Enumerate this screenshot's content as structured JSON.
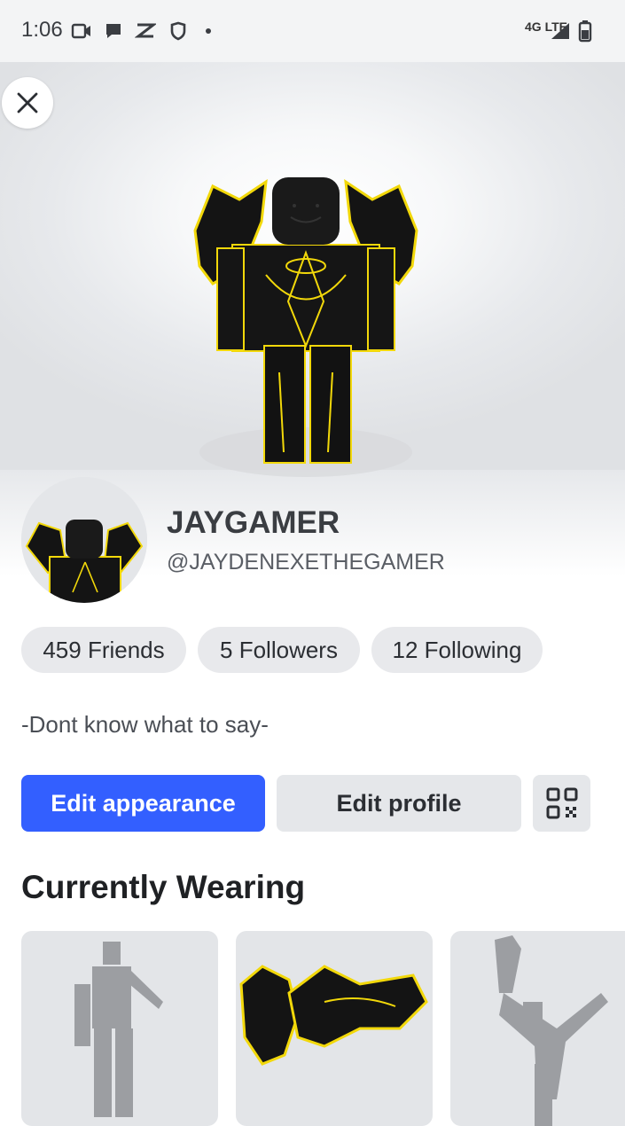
{
  "status_bar": {
    "time": "1:06",
    "network": "4G LTE",
    "icons": [
      "video-icon",
      "chat-icon",
      "capcut-icon",
      "shield-icon",
      "dot-icon",
      "signal-icon",
      "battery-icon"
    ]
  },
  "profile": {
    "display_name": "JAYGAMER",
    "username": "@JAYDENEXETHEGAMER",
    "bio": "-Dont know what to say-"
  },
  "stats": {
    "friends": "459 Friends",
    "followers": "5 Followers",
    "following": "12 Following"
  },
  "actions": {
    "edit_appearance": "Edit appearance",
    "edit_profile": "Edit profile"
  },
  "wearing": {
    "title": "Currently Wearing",
    "items": [
      "emote-animation-item",
      "dragon-shoulder-item",
      "kick-animation-item"
    ]
  },
  "colors": {
    "accent": "#335fff",
    "glow": "#f2d80a"
  }
}
